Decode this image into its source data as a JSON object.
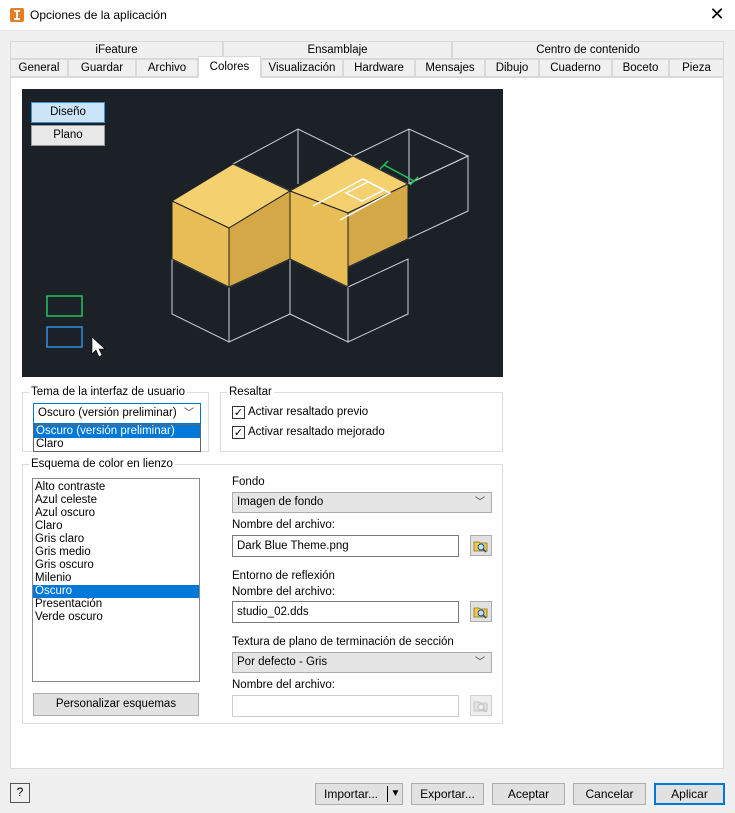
{
  "window": {
    "title": "Opciones de la aplicación",
    "close_glyph": "✕"
  },
  "tabs_row1": [
    "iFeature",
    "Ensamblaje",
    "Centro de contenido"
  ],
  "tabs_row2": [
    "General",
    "Guardar",
    "Archivo",
    "Colores",
    "Visualización",
    "Hardware",
    "Mensajes",
    "Dibujo",
    "Cuaderno",
    "Boceto",
    "Pieza"
  ],
  "active_tab": "Colores",
  "preview": {
    "design_label": "Diseño",
    "plain_label": "Plano",
    "background": "#1c2128",
    "part_color": "#e8bd55"
  },
  "ui_theme": {
    "group_label": "Tema de la interfaz de usuario",
    "selected": "Oscuro (versión preliminar)",
    "options": [
      "Oscuro (versión preliminar)",
      "Claro"
    ]
  },
  "highlight": {
    "group_label": "Resaltar",
    "preview_highlight": "Activar resaltado previo",
    "enhanced_highlight": "Activar resaltado mejorado"
  },
  "color_scheme": {
    "group_label": "Esquema de color en lienzo",
    "schemes": [
      "Alto contraste",
      "Azul celeste",
      "Azul oscuro",
      "Claro",
      "Gris claro",
      "Gris medio",
      "Gris oscuro",
      "Milenio",
      "Oscuro",
      "Presentación",
      "Verde oscuro"
    ],
    "selected": "Oscuro",
    "customize_button": "Personalizar esquemas"
  },
  "background": {
    "label": "Fondo",
    "value": "Imagen de fondo",
    "filename_label": "Nombre del archivo:",
    "filename": "Dark Blue Theme.png"
  },
  "reflection": {
    "label": "Entorno de reflexión",
    "filename_label": "Nombre del archivo:",
    "filename": "studio_02.dds"
  },
  "section_texture": {
    "label": "Textura de plano de terminación de sección",
    "value": "Por defecto - Gris",
    "filename_label": "Nombre del archivo:",
    "filename": ""
  },
  "footer": {
    "help_icon": "?",
    "import_label": "Importar...",
    "export_label": "Exportar...",
    "ok_label": "Aceptar",
    "cancel_label": "Cancelar",
    "apply_label": "Aplicar"
  }
}
